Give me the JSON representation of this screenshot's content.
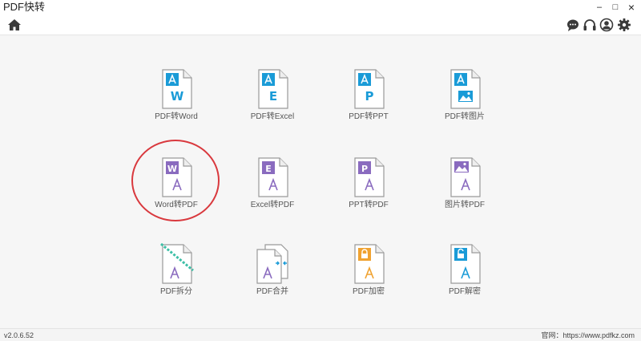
{
  "window": {
    "title": "PDF快转",
    "minimize": "–",
    "maximize": "□",
    "close": "×"
  },
  "toolbar": {
    "icons": [
      "home-icon",
      "chat-icon",
      "headset-icon",
      "user-icon",
      "gear-icon"
    ]
  },
  "colors": {
    "pdf_blue": "#1a9bd7",
    "word_purple": "#8a6bbf",
    "pdf_orange": "#f0a230",
    "annotation_red": "#d9393e",
    "acrobat_gray": "#7a7a7a"
  },
  "tools": {
    "row1": [
      {
        "label": "PDF转Word",
        "badge": "W"
      },
      {
        "label": "PDF转Excel",
        "badge": "E"
      },
      {
        "label": "PDF转PPT",
        "badge": "P"
      },
      {
        "label": "PDF转图片",
        "badge": "image-icon"
      }
    ],
    "row2": [
      {
        "label": "Word转PDF",
        "badge": "W"
      },
      {
        "label": "Excel转PDF",
        "badge": "E"
      },
      {
        "label": "PPT转PDF",
        "badge": "P"
      },
      {
        "label": "图片转PDF",
        "badge": "image-icon"
      }
    ],
    "row3": [
      {
        "label": "PDF拆分",
        "badge": "split-icon"
      },
      {
        "label": "PDF合并",
        "badge": "merge-icon"
      },
      {
        "label": "PDF加密",
        "badge": "lock-icon"
      },
      {
        "label": "PDF解密",
        "badge": "unlock-icon"
      }
    ]
  },
  "footer": {
    "version": "v2.0.6.52",
    "website": "官网：https://www.pdfkz.com"
  }
}
